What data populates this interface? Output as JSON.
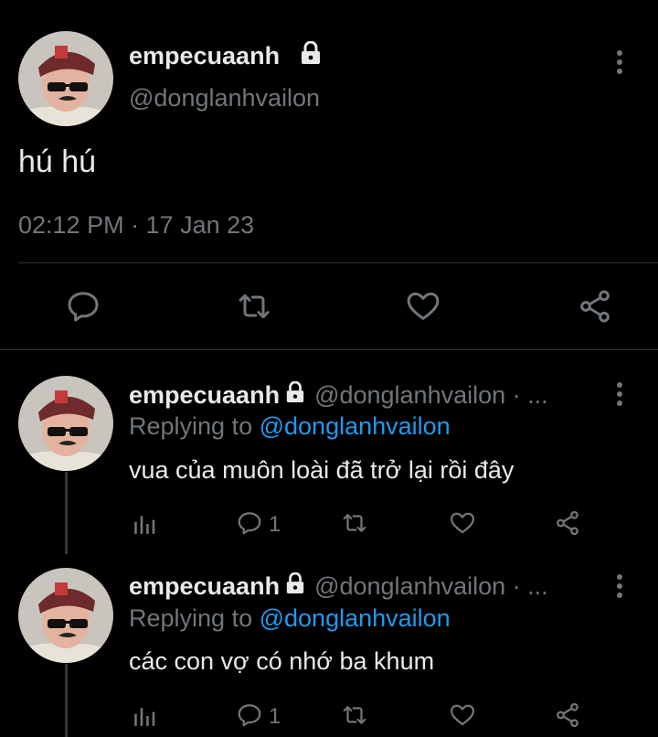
{
  "main_tweet": {
    "display_name": "empecuaanh",
    "handle": "@donglanhvailon",
    "text": "hú hú",
    "timestamp": "02:12 PM · 17 Jan 23"
  },
  "replies": [
    {
      "display_name": "empecuaanh",
      "handle_meta": "@donglanhvailon · ...",
      "replying_prefix": "Replying to",
      "replying_handle": "@donglanhvailon",
      "text": "vua của muôn loài đã trở lại rồi đây",
      "reply_count": "1"
    },
    {
      "display_name": "empecuaanh",
      "handle_meta": "@donglanhvailon · ...",
      "replying_prefix": "Replying to",
      "replying_handle": "@donglanhvailon",
      "text": "các con vợ có nhớ ba khum",
      "reply_count": "1"
    }
  ],
  "colors": {
    "background": "#000000",
    "text_primary": "#e7e9ea",
    "text_secondary": "#71767b",
    "link": "#1d9bf0",
    "divider": "#2f3336"
  },
  "icons": [
    "lock-icon",
    "more-icon",
    "reply-icon",
    "retweet-icon",
    "like-icon",
    "share-icon",
    "analytics-icon"
  ]
}
